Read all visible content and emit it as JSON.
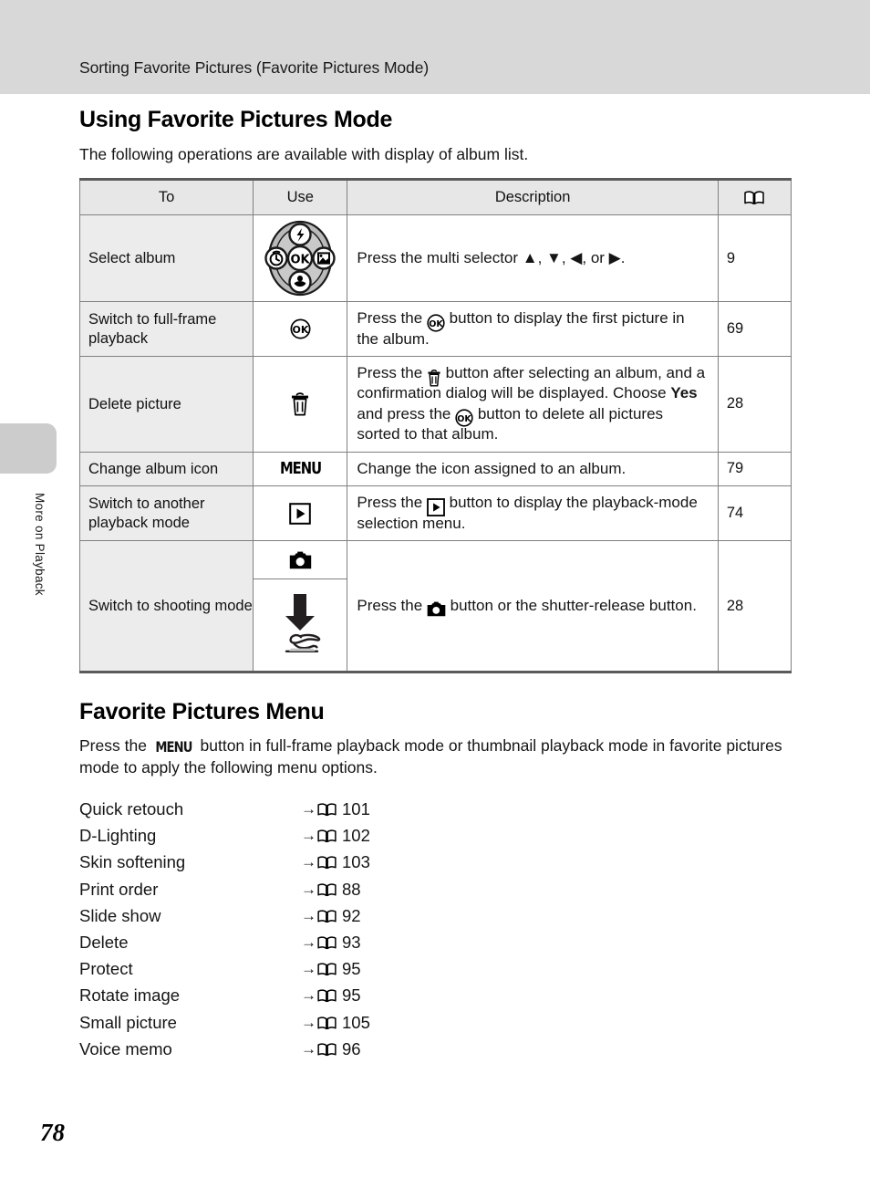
{
  "header": {
    "running_title": "Sorting Favorite Pictures (Favorite Pictures Mode)"
  },
  "side_tab": {
    "label": "More on Playback"
  },
  "page_number": "78",
  "section": {
    "title": "Using Favorite Pictures Mode",
    "intro": "The following operations are available with display of album list."
  },
  "table": {
    "headers": {
      "to": "To",
      "use": "Use",
      "description": "Description",
      "reference_icon": "open-book-icon"
    },
    "rows": [
      {
        "to": "Select album",
        "use_icon": "multi-selector-dial-icon",
        "desc_parts": [
          {
            "type": "text",
            "value": "Press the multi selector "
          },
          {
            "type": "glyph",
            "value": "▲"
          },
          {
            "type": "text",
            "value": ", "
          },
          {
            "type": "glyph",
            "value": "▼"
          },
          {
            "type": "text",
            "value": ", "
          },
          {
            "type": "glyph",
            "value": "◀"
          },
          {
            "type": "text",
            "value": ", or "
          },
          {
            "type": "glyph",
            "value": "▶"
          },
          {
            "type": "text",
            "value": "."
          }
        ],
        "desc_plain": "Press the multi selector ▲, ▼, ◀, or ▶.",
        "ref": "9"
      },
      {
        "to": "Switch to full-frame playback",
        "use_icon": "ok-button-icon",
        "desc_plain": "Press the OK button to display the first picture in the album.",
        "ref": "69"
      },
      {
        "to": "Delete picture",
        "use_icon": "trash-icon",
        "desc_plain": "Press the trash button after selecting an album, and a confirmation dialog will be displayed. Choose Yes and press the OK button to delete all pictures sorted to that album.",
        "emphasis": "Yes",
        "ref": "28"
      },
      {
        "to": "Change album icon",
        "use_icon": "menu-button-icon",
        "use_label": "MENU",
        "desc_plain": "Change the icon assigned to an album.",
        "ref": "79"
      },
      {
        "to": "Switch to another playback mode",
        "use_icon": "playback-button-icon",
        "desc_plain": "Press the playback button to display the playback-mode selection menu.",
        "ref": "74"
      },
      {
        "to": "Switch to shooting mode",
        "use_icon_top": "camera-button-icon",
        "use_icon_bottom": "shutter-release-press-icon",
        "desc_plain": "Press the camera button or the shutter-release button.",
        "ref": "28"
      }
    ]
  },
  "menu_section": {
    "title": "Favorite Pictures Menu",
    "intro_before": "Press the ",
    "intro_menu_word": "MENU",
    "intro_after": " button in full-frame playback mode or thumbnail playback mode in favorite pictures mode to apply the following menu options.",
    "items": [
      {
        "label": "Quick retouch",
        "arrow": "→",
        "ref_icon": "open-book-icon",
        "page": "101"
      },
      {
        "label": "D-Lighting",
        "arrow": "→",
        "ref_icon": "open-book-icon",
        "page": "102"
      },
      {
        "label": "Skin softening",
        "arrow": "→",
        "ref_icon": "open-book-icon",
        "page": "103"
      },
      {
        "label": "Print order",
        "arrow": "→",
        "ref_icon": "open-book-icon",
        "page": "88"
      },
      {
        "label": "Slide show",
        "arrow": "→",
        "ref_icon": "open-book-icon",
        "page": "92"
      },
      {
        "label": "Delete",
        "arrow": "→",
        "ref_icon": "open-book-icon",
        "page": "93"
      },
      {
        "label": "Protect",
        "arrow": "→",
        "ref_icon": "open-book-icon",
        "page": "95"
      },
      {
        "label": "Rotate image",
        "arrow": "→",
        "ref_icon": "open-book-icon",
        "page": "95"
      },
      {
        "label": "Small picture",
        "arrow": "→",
        "ref_icon": "open-book-icon",
        "page": "105"
      },
      {
        "label": "Voice memo",
        "arrow": "→",
        "ref_icon": "open-book-icon",
        "page": "96"
      }
    ]
  },
  "colors": {
    "header_band": "#d8d8d8",
    "side_tab": "#cccccc",
    "table_head": "#e7e7e7",
    "table_first_col": "#ececec",
    "rule": "#808080",
    "heavy_rule": "#5a5a5a"
  }
}
